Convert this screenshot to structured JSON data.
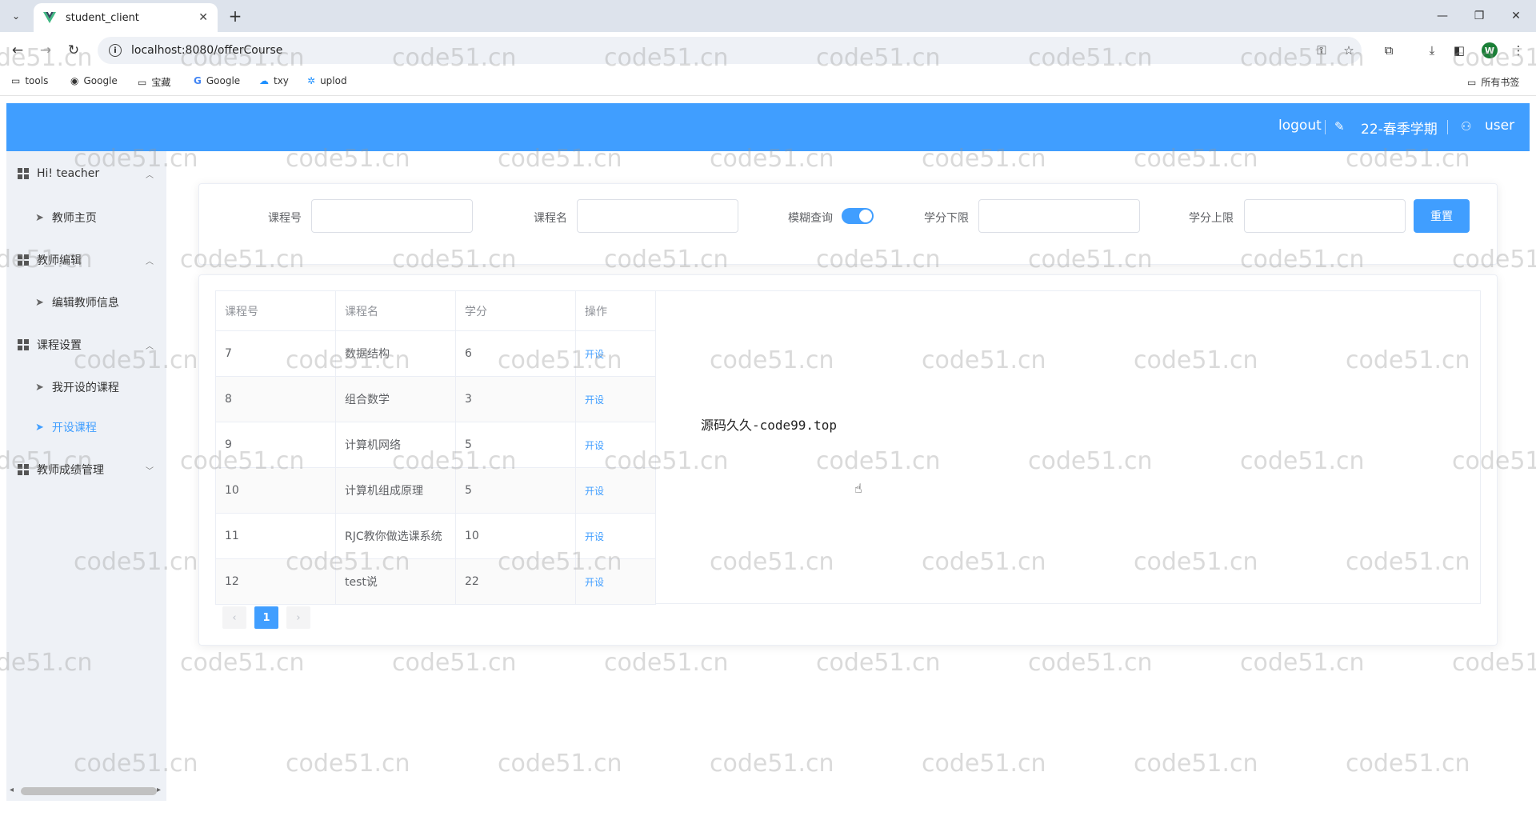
{
  "browser": {
    "tab_title": "student_client",
    "url": "localhost:8080/offerCourse",
    "bookmarks": [
      "tools",
      "Google",
      "宝藏",
      "Google",
      "txy",
      "uplod"
    ],
    "bookmarks_right": "所有书签",
    "profile_initial": "W"
  },
  "header": {
    "logout": "logout",
    "term": "22-春季学期",
    "user": "user"
  },
  "sidebar": {
    "groups": [
      {
        "label": "Hi! teacher",
        "items": [
          "教师主页"
        ]
      },
      {
        "label": "教师编辑",
        "items": [
          "编辑教师信息"
        ]
      },
      {
        "label": "课程设置",
        "items": [
          "我开设的课程",
          "开设课程"
        ]
      },
      {
        "label": "教师成绩管理",
        "items": []
      }
    ],
    "active_item": "开设课程"
  },
  "search": {
    "course_id_label": "课程号",
    "course_name_label": "课程名",
    "fuzzy_label": "模糊查询",
    "fuzzy_enabled": true,
    "credit_min_label": "学分下限",
    "credit_max_label": "学分上限",
    "reset_label": "重置"
  },
  "table": {
    "headers": [
      "课程号",
      "课程名",
      "学分",
      "操作"
    ],
    "rows": [
      {
        "id": "7",
        "name": "数据结构",
        "credit": "6",
        "op": "开设"
      },
      {
        "id": "8",
        "name": "组合数学",
        "credit": "3",
        "op": "开设"
      },
      {
        "id": "9",
        "name": "计算机网络",
        "credit": "5",
        "op": "开设"
      },
      {
        "id": "10",
        "name": "计算机组成原理",
        "credit": "5",
        "op": "开设"
      },
      {
        "id": "11",
        "name": "RJC教你做选课系统",
        "credit": "10",
        "op": "开设"
      },
      {
        "id": "12",
        "name": "test说",
        "credit": "22",
        "op": "开设"
      }
    ]
  },
  "overlay_text": "源码久久-code99.top",
  "pagination": {
    "current": "1",
    "prev": "‹",
    "next": "›"
  },
  "watermark": "code51.cn",
  "colors": {
    "primary": "#409eff",
    "sidebar_bg": "#eef1f6"
  }
}
